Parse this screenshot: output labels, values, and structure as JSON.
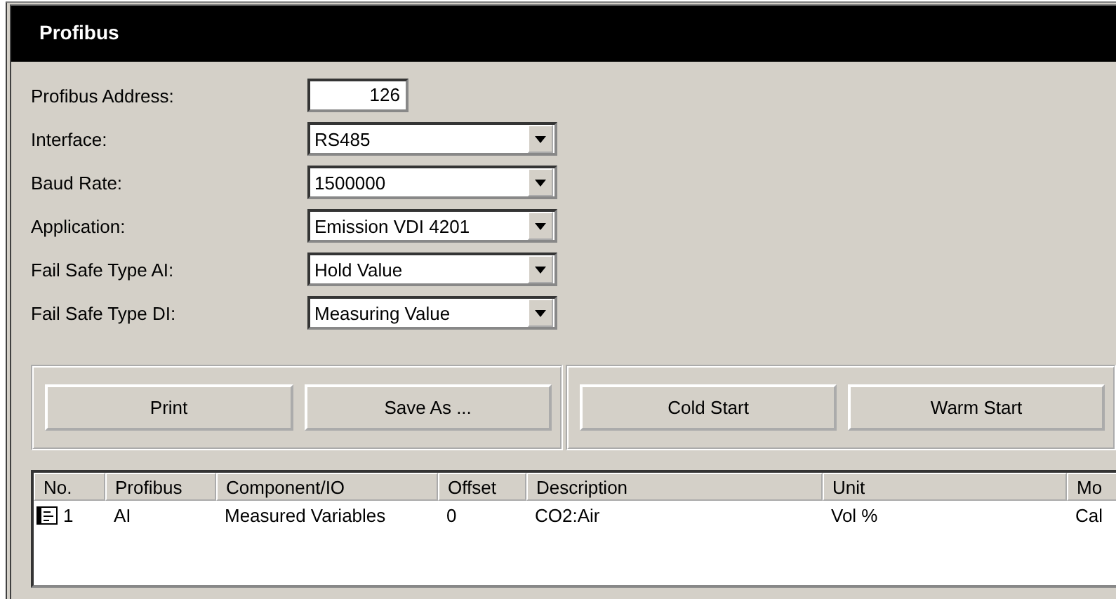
{
  "window": {
    "title": "Profibus"
  },
  "fields": [
    {
      "kind": "text",
      "label": "Profibus Address:",
      "value": "126"
    },
    {
      "kind": "combo",
      "label": "Interface:",
      "value": "RS485"
    },
    {
      "kind": "combo",
      "label": "Baud Rate:",
      "value": "1500000"
    },
    {
      "kind": "combo",
      "label": "Application:",
      "value": "Emission VDI 4201"
    },
    {
      "kind": "combo",
      "label": "Fail Safe Type AI:",
      "value": "Hold Value"
    },
    {
      "kind": "combo",
      "label": "Fail Safe Type DI:",
      "value": "Measuring Value"
    }
  ],
  "button_groups": [
    [
      "Print",
      "Save As ..."
    ],
    [
      "Cold Start",
      "Warm Start"
    ]
  ],
  "table": {
    "columns": [
      "No.",
      "Profibus",
      "Component/IO",
      "Offset",
      "Description",
      "Unit",
      "Mo"
    ],
    "rows": [
      {
        "cells": [
          "1",
          "AI",
          "Measured Variables",
          "0",
          "CO2:Air",
          "Vol %",
          "Cal"
        ]
      }
    ]
  }
}
